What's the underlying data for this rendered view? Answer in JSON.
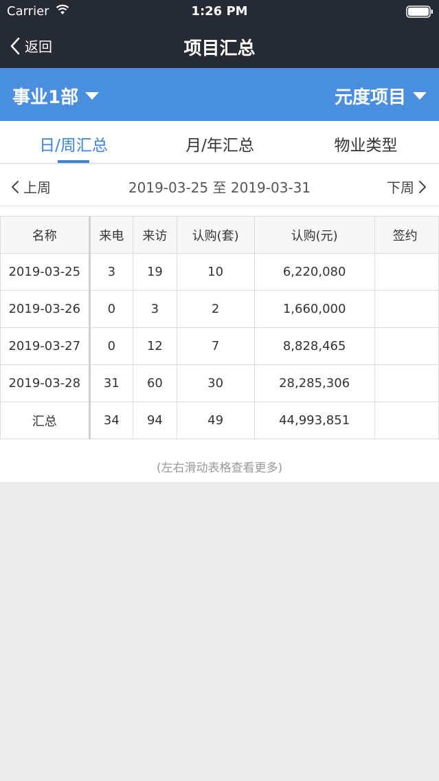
{
  "status_bar": {
    "carrier": "Carrier",
    "time": "1:26 PM"
  },
  "nav": {
    "back_label": "返回",
    "title": "项目汇总"
  },
  "filters": {
    "department": "事业1部",
    "project": "元度项目"
  },
  "tabs": [
    {
      "label": "日/周汇总",
      "active": true
    },
    {
      "label": "月/年汇总",
      "active": false
    },
    {
      "label": "物业类型",
      "active": false
    }
  ],
  "week_nav": {
    "prev": "上周",
    "range": "2019-03-25 至 2019-03-31",
    "next": "下周"
  },
  "table": {
    "headers": [
      "名称",
      "来电",
      "来访",
      "认购(套)",
      "认购(元)",
      "签约"
    ],
    "rows": [
      [
        "2019-03-25",
        "3",
        "19",
        "10",
        "6,220,080",
        ""
      ],
      [
        "2019-03-26",
        "0",
        "3",
        "2",
        "1,660,000",
        ""
      ],
      [
        "2019-03-27",
        "0",
        "12",
        "7",
        "8,828,465",
        ""
      ],
      [
        "2019-03-28",
        "31",
        "60",
        "30",
        "28,285,306",
        ""
      ],
      [
        "汇总",
        "34",
        "94",
        "49",
        "44,993,851",
        ""
      ]
    ]
  },
  "hint": "(左右滑动表格查看更多)",
  "colors": {
    "nav_bg": "#262a33",
    "filter_bg": "#4a8ee0",
    "accent": "#3a84d8"
  }
}
